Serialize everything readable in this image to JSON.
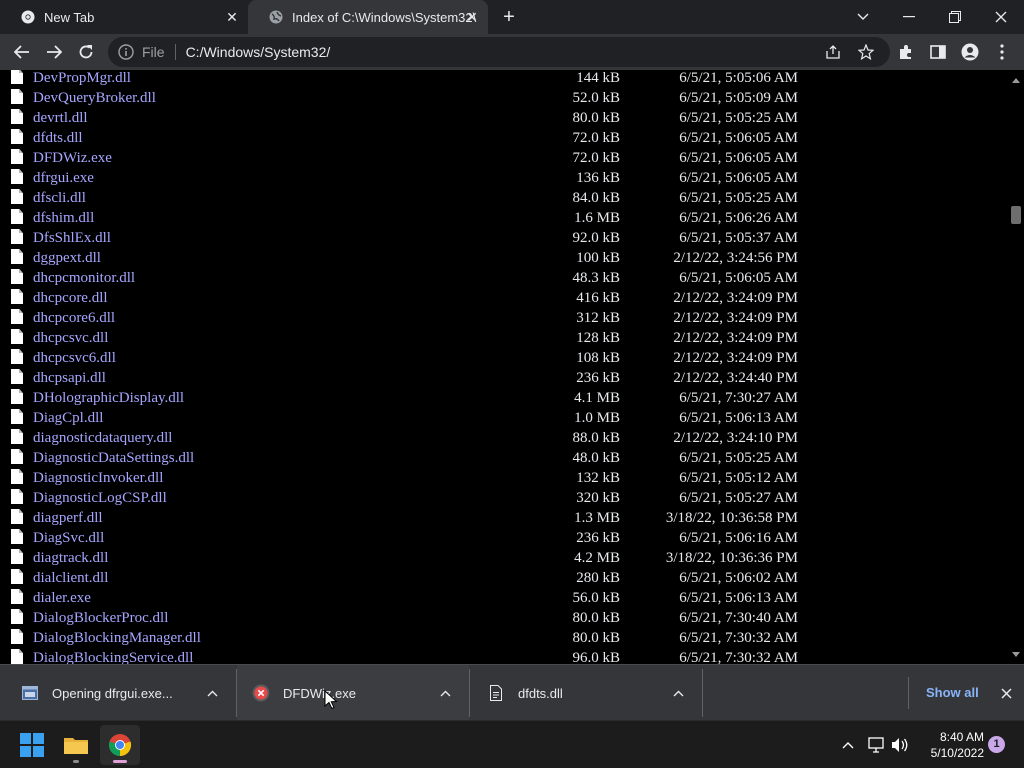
{
  "browser": {
    "tabs": [
      {
        "title": "New Tab",
        "icon": "chrome-icon",
        "active": false
      },
      {
        "title": "Index of C:\\Windows\\System32\\",
        "icon": "globe-icon",
        "active": true
      }
    ],
    "address": {
      "scheme_label": "File",
      "url": "C:/Windows/System32/"
    }
  },
  "listing": {
    "files": [
      {
        "name": "DevPropMgr.dll",
        "size": "144 kB",
        "date": "6/5/21, 5:05:06 AM"
      },
      {
        "name": "DevQueryBroker.dll",
        "size": "52.0 kB",
        "date": "6/5/21, 5:05:09 AM"
      },
      {
        "name": "devrtl.dll",
        "size": "80.0 kB",
        "date": "6/5/21, 5:05:25 AM"
      },
      {
        "name": "dfdts.dll",
        "size": "72.0 kB",
        "date": "6/5/21, 5:06:05 AM"
      },
      {
        "name": "DFDWiz.exe",
        "size": "72.0 kB",
        "date": "6/5/21, 5:06:05 AM"
      },
      {
        "name": "dfrgui.exe",
        "size": "136 kB",
        "date": "6/5/21, 5:06:05 AM"
      },
      {
        "name": "dfscli.dll",
        "size": "84.0 kB",
        "date": "6/5/21, 5:05:25 AM"
      },
      {
        "name": "dfshim.dll",
        "size": "1.6 MB",
        "date": "6/5/21, 5:06:26 AM"
      },
      {
        "name": "DfsShlEx.dll",
        "size": "92.0 kB",
        "date": "6/5/21, 5:05:37 AM"
      },
      {
        "name": "dggpext.dll",
        "size": "100 kB",
        "date": "2/12/22, 3:24:56 PM"
      },
      {
        "name": "dhcpcmonitor.dll",
        "size": "48.3 kB",
        "date": "6/5/21, 5:06:05 AM"
      },
      {
        "name": "dhcpcore.dll",
        "size": "416 kB",
        "date": "2/12/22, 3:24:09 PM"
      },
      {
        "name": "dhcpcore6.dll",
        "size": "312 kB",
        "date": "2/12/22, 3:24:09 PM"
      },
      {
        "name": "dhcpcsvc.dll",
        "size": "128 kB",
        "date": "2/12/22, 3:24:09 PM"
      },
      {
        "name": "dhcpcsvc6.dll",
        "size": "108 kB",
        "date": "2/12/22, 3:24:09 PM"
      },
      {
        "name": "dhcpsapi.dll",
        "size": "236 kB",
        "date": "2/12/22, 3:24:40 PM"
      },
      {
        "name": "DHolographicDisplay.dll",
        "size": "4.1 MB",
        "date": "6/5/21, 7:30:27 AM"
      },
      {
        "name": "DiagCpl.dll",
        "size": "1.0 MB",
        "date": "6/5/21, 5:06:13 AM"
      },
      {
        "name": "diagnosticdataquery.dll",
        "size": "88.0 kB",
        "date": "2/12/22, 3:24:10 PM"
      },
      {
        "name": "DiagnosticDataSettings.dll",
        "size": "48.0 kB",
        "date": "6/5/21, 5:05:25 AM"
      },
      {
        "name": "DiagnosticInvoker.dll",
        "size": "132 kB",
        "date": "6/5/21, 5:05:12 AM"
      },
      {
        "name": "DiagnosticLogCSP.dll",
        "size": "320 kB",
        "date": "6/5/21, 5:05:27 AM"
      },
      {
        "name": "diagperf.dll",
        "size": "1.3 MB",
        "date": "3/18/22, 10:36:58 PM"
      },
      {
        "name": "DiagSvc.dll",
        "size": "236 kB",
        "date": "6/5/21, 5:06:16 AM"
      },
      {
        "name": "diagtrack.dll",
        "size": "4.2 MB",
        "date": "3/18/22, 10:36:36 PM"
      },
      {
        "name": "dialclient.dll",
        "size": "280 kB",
        "date": "6/5/21, 5:06:02 AM"
      },
      {
        "name": "dialer.exe",
        "size": "56.0 kB",
        "date": "6/5/21, 5:06:13 AM"
      },
      {
        "name": "DialogBlockerProc.dll",
        "size": "80.0 kB",
        "date": "6/5/21, 7:30:40 AM"
      },
      {
        "name": "DialogBlockingManager.dll",
        "size": "80.0 kB",
        "date": "6/5/21, 7:30:32 AM"
      },
      {
        "name": "DialogBlockingService.dll",
        "size": "96.0 kB",
        "date": "6/5/21, 7:30:32 AM"
      }
    ]
  },
  "downloads": {
    "items": [
      {
        "label": "Opening dfrgui.exe...",
        "icon": "app-window-icon",
        "state": "opening"
      },
      {
        "label": "DFDWiz.exe",
        "icon": "error-icon",
        "state": "failed"
      },
      {
        "label": "dfdts.dll",
        "icon": "file-icon",
        "state": "complete"
      }
    ],
    "show_all_label": "Show all"
  },
  "taskbar": {
    "apps": [
      "start-icon",
      "file-explorer-icon",
      "chrome-icon"
    ],
    "time": "8:40 AM",
    "date": "5/10/2022",
    "notification_count": "1"
  },
  "colors": {
    "link": "#a6a6ff",
    "tab_strip": "#202124",
    "toolbar": "#35363a",
    "error": "#e84a4a",
    "show_all": "#8ab4f8"
  }
}
